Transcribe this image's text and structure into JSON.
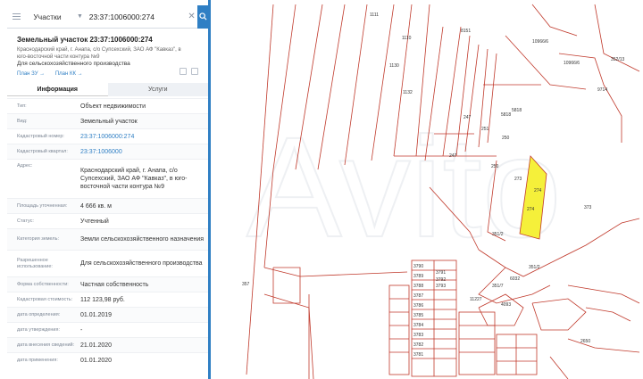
{
  "search": {
    "category": "Участки",
    "query": "23:37:1006000:274"
  },
  "object": {
    "title": "Земельный участок 23:37:1006000:274",
    "address_small": "Краснодарский край, г. Анапа, с/о Супсехский, ЗАО АФ \"Кавказ\", в юго-восточной части контура №9",
    "purpose_small": "Для сельскохозяйственного производства"
  },
  "links": {
    "plan_zu": "План ЗУ →",
    "plan_kk": "План КК →"
  },
  "tabs": {
    "info": "Информация",
    "services": "Услуги"
  },
  "info_rows": [
    {
      "label": "Тип:",
      "value": "Объект недвижимости"
    },
    {
      "label": "Вид:",
      "value": "Земельный участок"
    },
    {
      "label": "Кадастровый номер:",
      "value": "23:37:1006000:274"
    },
    {
      "label": "Кадастровый квартал:",
      "value": "23:37:1006000"
    },
    {
      "label": "Адрес:",
      "value": "Краснодарский край, г. Анапа, с/о Супсехский, ЗАО АФ \"Кавказ\", в юго-восточной части контура №9"
    },
    {
      "label": "Площадь уточненная:",
      "value": "4 666 кв. м"
    },
    {
      "label": "Статус:",
      "value": "Учтенный"
    },
    {
      "label": "Категория земель:",
      "value": "Земли сельскохозяйственного назначения"
    },
    {
      "label": "Разрешенное использование:",
      "value": "Для сельскохозяйственного производства"
    },
    {
      "label": "Форма собственности:",
      "value": "Частная собственность"
    },
    {
      "label": "Кадастровая стоимость:",
      "value": "112 123,98 руб."
    },
    {
      "label": "дата определения:",
      "value": "01.01.2019"
    },
    {
      "label": "дата утверждения:",
      "value": "-"
    },
    {
      "label": "дата внесения сведений:",
      "value": "21.01.2020"
    },
    {
      "label": "дата применения:",
      "value": "01.01.2020"
    }
  ],
  "map_labels": [
    "1111",
    "1110",
    "1130",
    "8151",
    "1132",
    "10966/6",
    "10966/6",
    "9714",
    "352/13",
    "5818",
    "5818",
    "247",
    "251",
    "250",
    "247",
    "250",
    "273",
    "274",
    "274",
    "373",
    "351/2",
    "351/2",
    "6032",
    "351/7",
    "11227",
    "4093",
    "357",
    "3790",
    "3791",
    "3789",
    "3788",
    "3787",
    "3786",
    "3785",
    "3784",
    "3783",
    "3782",
    "3781",
    "3793",
    "3792",
    "2650"
  ],
  "watermark": "Avito",
  "colors": {
    "accent": "#2f7fc4",
    "plot_line": "#c0392b",
    "highlight": "#f5f03a"
  }
}
